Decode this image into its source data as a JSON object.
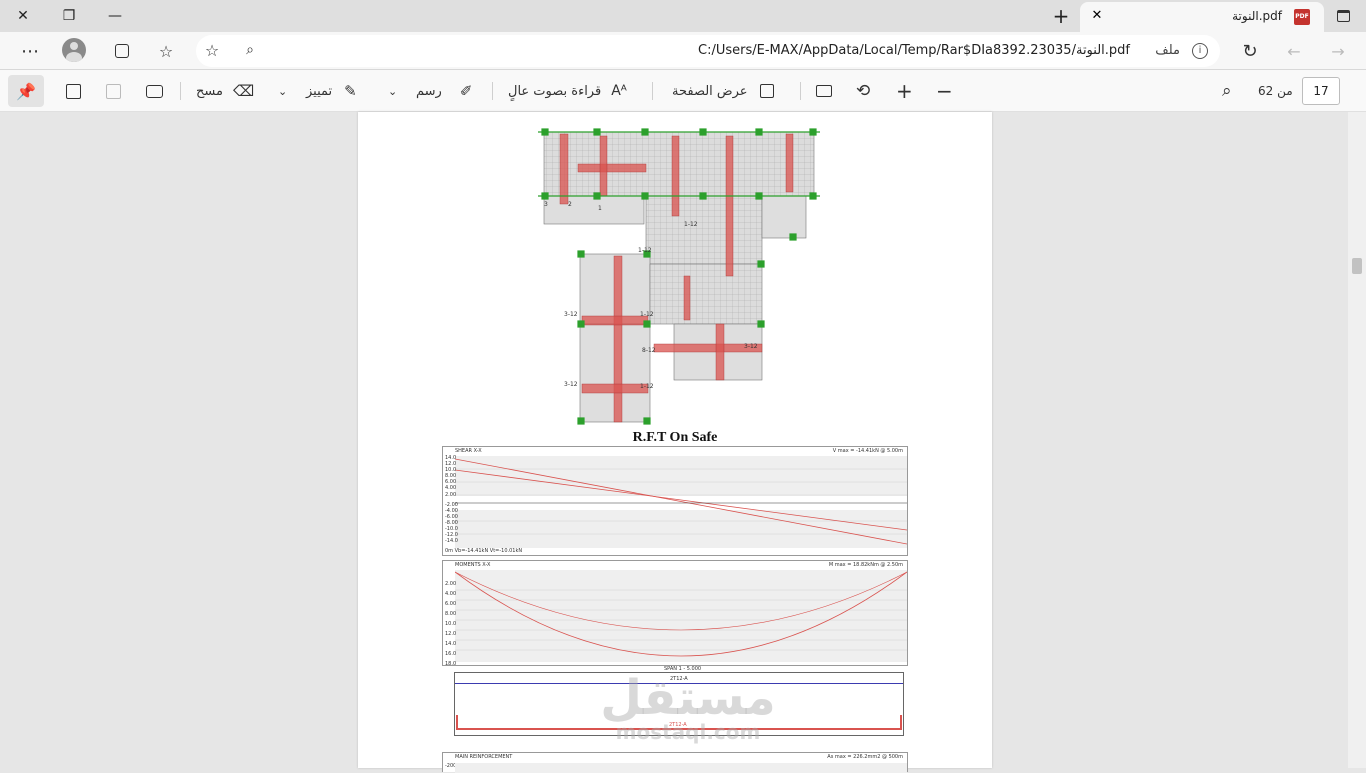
{
  "window": {
    "tab_title": "النوتة.pdf",
    "tab_icon": "pdf-icon",
    "close_label": "✕",
    "restore_label": "❐",
    "minimize_label": "—",
    "new_tab_label": "+"
  },
  "address": {
    "url": "C:/Users/E-MAX/AppData/Local/Temp/Rar$DIa8392.23035/النوتة.pdf",
    "file_label": "ملف"
  },
  "toolbar": {
    "erase_label": "مسح",
    "highlight_label": "تمييز",
    "draw_label": "رسم",
    "read_aloud_label": "قراءة بصوت عالٍ",
    "page_view_label": "عرض الصفحة",
    "page_total_label": "من 62",
    "current_page": "17"
  },
  "document": {
    "plan_title": "R.F.T On Safe",
    "watermark_ar": "مستقل",
    "watermark_en": "mostaql.com",
    "shear_chart": {
      "title": "SHEAR X-X",
      "summary": "V max = -14.41kN @ 5.00m",
      "footer": "0m  Vb=-14.41kN  Vt=-10.01kN",
      "y_ticks": [
        "14.0",
        "12.0",
        "10.0",
        "8.00",
        "6.00",
        "4.00",
        "2.00",
        "-2.00",
        "-4.00",
        "-6.00",
        "-8.00",
        "-10.0",
        "-12.0",
        "-14.0"
      ]
    },
    "moment_chart": {
      "title": "MOMENTS X-X",
      "summary": "M max = 18.82kNm @ 2.50m",
      "y_ticks": [
        "2.00",
        "4.00",
        "6.00",
        "8.00",
        "10.0",
        "12.0",
        "14.0",
        "16.0",
        "18.0"
      ],
      "span_label": "SPAN 1 - 5.000"
    },
    "rebar": {
      "top_label": "2T12-A",
      "bottom_label": "2T12-A"
    },
    "reinforcement_chart": {
      "title": "MAIN REINFORCEMENT",
      "summary": "As max = 226.2mm2 @ 500m",
      "y_tick": "-200"
    }
  }
}
